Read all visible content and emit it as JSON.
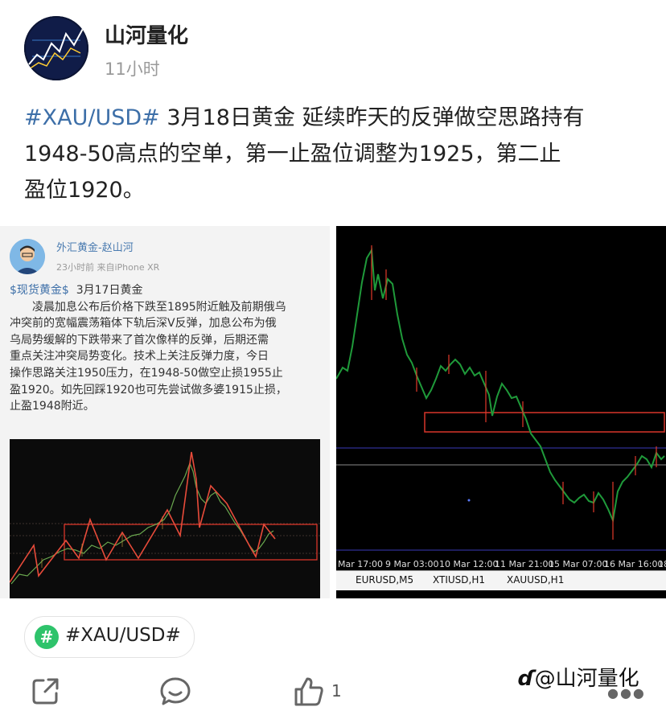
{
  "author": {
    "name": "山河量化",
    "time": "11小时"
  },
  "post": {
    "hashtag": "#XAU/USD#",
    "text_line1": " 3月18日黄金 延续昨天的反弹做空思路持有",
    "text_line2": "1948-50高点的空单，第一止盈位调整为1925，第二止",
    "text_line3": "盈位1920。"
  },
  "left_image": {
    "name": "外汇黄金-赵山河",
    "meta": "23小时前  来自iPhone XR",
    "hashtag": "$现货黄金$",
    "date_title": "3月17日黄金",
    "body_lines": [
      "凌晨加息公布后价格下跌至1895附近触及前期俄乌",
      "冲突前的宽幅震荡箱体下轨后深V反弹，加息公布为俄",
      "乌局势缓解的下跌带来了首次像样的反弹，后期还需",
      "重点关注冲突局势变化。技术上关注反弹力度，今日",
      "操作思路关注1950压力，在1948-50做空止损1955止",
      "盈1920。如先回踩1920也可先尝试做多婆1915止损，",
      "止盈1948附近。"
    ]
  },
  "right_image": {
    "axis_labels": [
      "Mar 17:00",
      "9 Mar 03:00",
      "10 Mar 12:00",
      "11 Mar 21:00",
      "15 Mar 07:00",
      "16 Mar 16:00",
      "18"
    ],
    "tabs": [
      "EURUSD,M5",
      "XTIUSD,H1",
      "XAUUSD,H1"
    ]
  },
  "hashtag_chip": {
    "icon": "#",
    "label": "#XAU/USD#"
  },
  "actions": {
    "like_count": "1"
  },
  "watermark": "@山河量化",
  "colors": {
    "link": "#3d6fa8",
    "chip_icon": "#2ec36b"
  }
}
